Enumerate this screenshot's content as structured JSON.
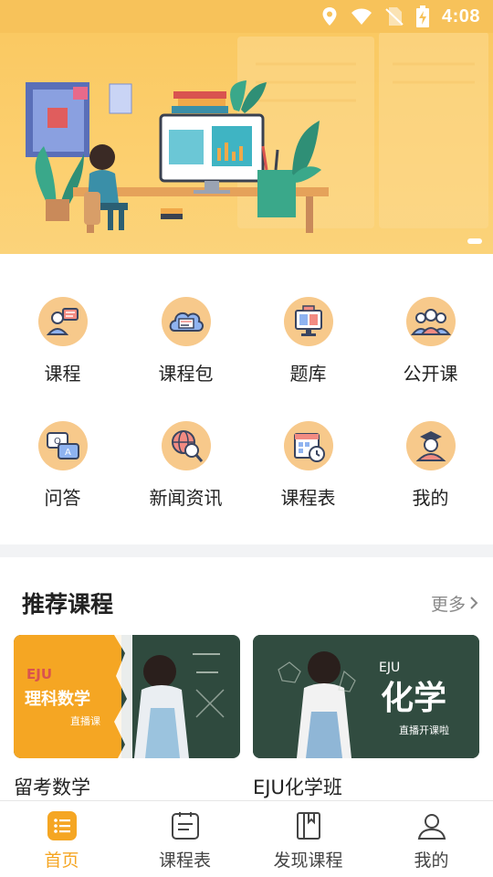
{
  "status_bar": {
    "time": "4:08",
    "icons": [
      "location-icon",
      "wifi-icon",
      "no-sim-icon",
      "battery-charging-icon"
    ]
  },
  "banner": {
    "illustration": "woman studying at desk with computer and books",
    "page_indicator": {
      "current": 1
    }
  },
  "menu": {
    "items": [
      {
        "label": "课程",
        "icon": "course-teacher-icon"
      },
      {
        "label": "课程包",
        "icon": "course-package-cloud-icon"
      },
      {
        "label": "题库",
        "icon": "question-bank-monitor-icon"
      },
      {
        "label": "公开课",
        "icon": "open-class-group-icon"
      },
      {
        "label": "问答",
        "icon": "qa-chat-icon"
      },
      {
        "label": "新闻资讯",
        "icon": "news-globe-icon"
      },
      {
        "label": "课程表",
        "icon": "schedule-calendar-icon"
      },
      {
        "label": "我的",
        "icon": "profile-graduate-icon"
      }
    ]
  },
  "recommended": {
    "title": "推荐课程",
    "more_label": "更多",
    "courses": [
      {
        "title": "留考数学",
        "thumb_text_1": "EJU",
        "thumb_text_2": "理科数学",
        "thumb_text_3": "直播课"
      },
      {
        "title": "EJU化学班",
        "thumb_text_1": "EJU",
        "thumb_text_2": "化学",
        "thumb_text_3": "直播开课啦"
      }
    ]
  },
  "tab_bar": {
    "tabs": [
      {
        "label": "首页",
        "icon": "home-list-icon",
        "active": true
      },
      {
        "label": "课程表",
        "icon": "schedule-icon",
        "active": false
      },
      {
        "label": "发现课程",
        "icon": "book-icon",
        "active": false
      },
      {
        "label": "我的",
        "icon": "user-icon",
        "active": false
      }
    ]
  },
  "colors": {
    "accent": "#f5a623",
    "banner_bg": "#fccf6e",
    "icon_circle": "#f7c98b",
    "chalkboard": "#2f4a3e"
  }
}
